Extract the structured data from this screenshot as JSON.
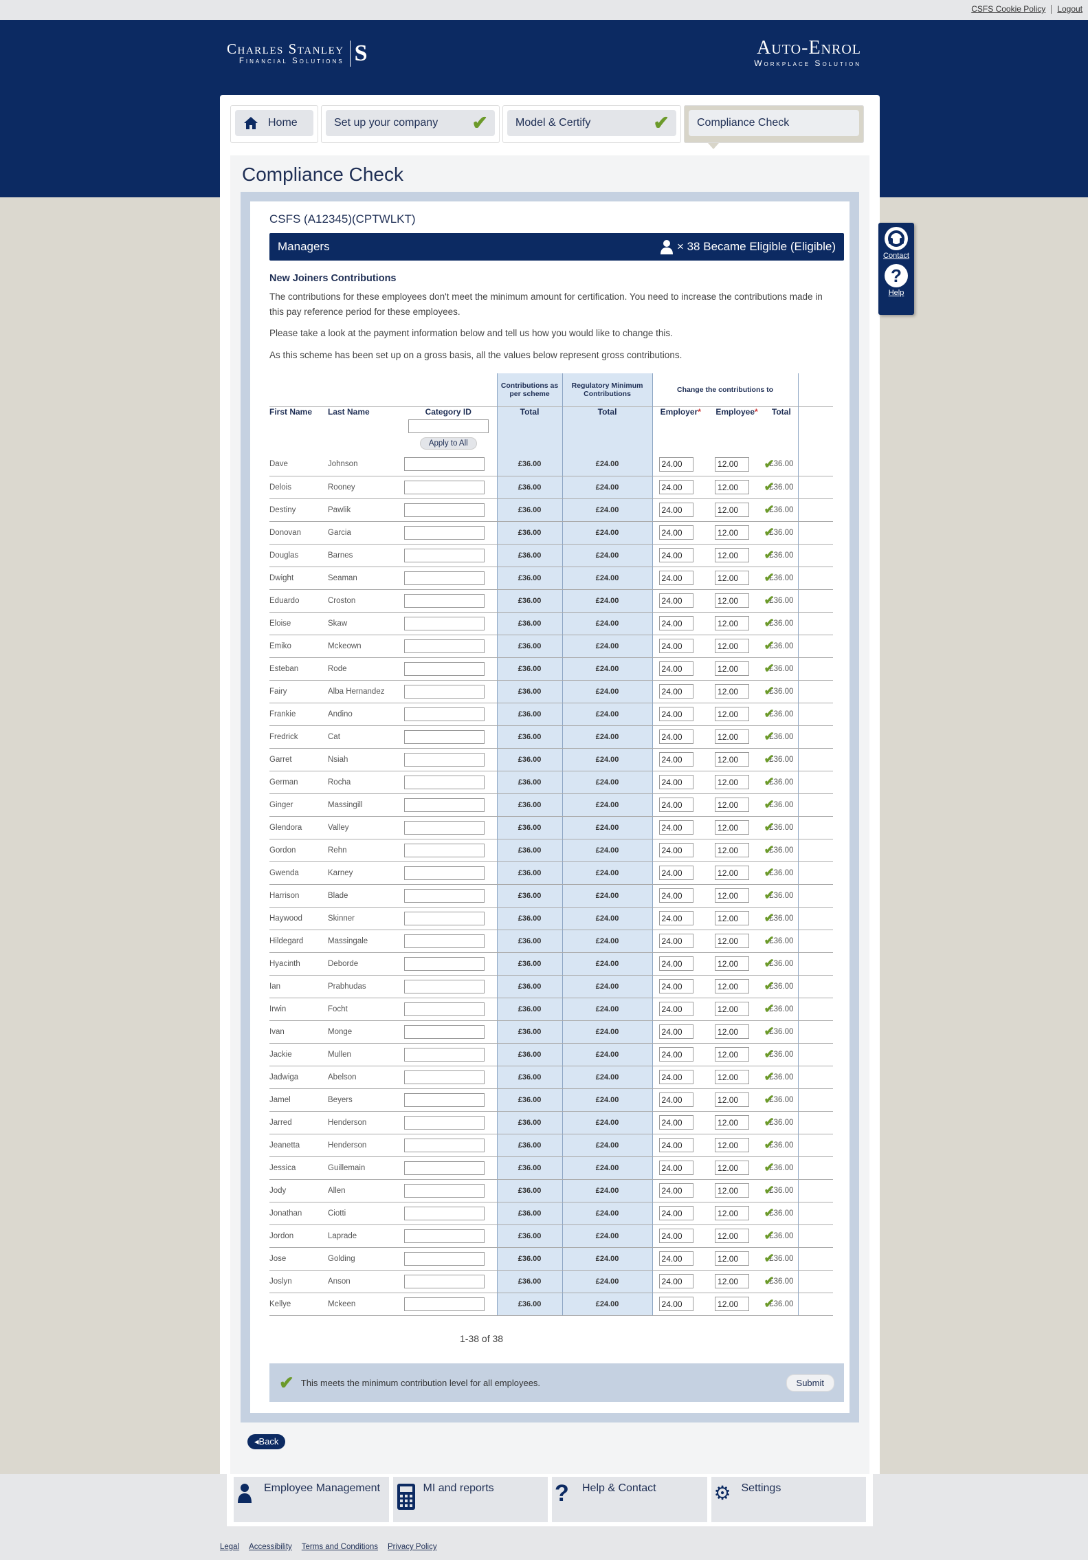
{
  "topbar": {
    "cookie_policy": "CSFS Cookie Policy",
    "logout": "Logout"
  },
  "brand": {
    "line1": "Charles Stanley",
    "line2": "Financial Solutions",
    "monogram": "S"
  },
  "product": {
    "line1": "Auto-Enrol",
    "line2": "Workplace Solution"
  },
  "tabs": [
    {
      "label": "Home",
      "icon": "home-icon"
    },
    {
      "label": "Set up your company",
      "complete": true
    },
    {
      "label": "Model & Certify",
      "complete": true
    },
    {
      "label": "Compliance Check",
      "active": true
    }
  ],
  "page": {
    "title": "Compliance Check",
    "company": "CSFS (A12345)(CPTWLKT)",
    "group": "Managers",
    "eligible_text": "× 38 Became Eligible (Eligible)",
    "section_heading": "New Joiners Contributions",
    "para1": "The contributions for these employees don't meet the minimum amount for certification. You need to increase the contributions made in this pay reference period for these employees.",
    "para2": "Please take a look at the payment information below and tell us how you would like to change this.",
    "para3": "As this scheme has been set up on a gross basis, all the values below represent gross contributions."
  },
  "table": {
    "group_headers": {
      "scheme": "Contributions as per scheme",
      "regulatory": "Regulatory Minimum Contributions",
      "change": "Change the contributions to"
    },
    "columns": {
      "first_name": "First Name",
      "last_name": "Last Name",
      "category": "Category ID",
      "total": "Total",
      "employer": "Employer",
      "employee": "Employee"
    },
    "apply_all": "Apply to All",
    "rows": [
      {
        "first": "Dave",
        "last": "Johnson",
        "scheme": "£36.00",
        "regulatory": "£24.00",
        "employer": "24.00",
        "employee": "12.00",
        "total": "£36.00"
      },
      {
        "first": "Delois",
        "last": "Rooney",
        "scheme": "£36.00",
        "regulatory": "£24.00",
        "employer": "24.00",
        "employee": "12.00",
        "total": "£36.00"
      },
      {
        "first": "Destiny",
        "last": "Pawlik",
        "scheme": "£36.00",
        "regulatory": "£24.00",
        "employer": "24.00",
        "employee": "12.00",
        "total": "£36.00"
      },
      {
        "first": "Donovan",
        "last": "Garcia",
        "scheme": "£36.00",
        "regulatory": "£24.00",
        "employer": "24.00",
        "employee": "12.00",
        "total": "£36.00"
      },
      {
        "first": "Douglas",
        "last": "Barnes",
        "scheme": "£36.00",
        "regulatory": "£24.00",
        "employer": "24.00",
        "employee": "12.00",
        "total": "£36.00"
      },
      {
        "first": "Dwight",
        "last": "Seaman",
        "scheme": "£36.00",
        "regulatory": "£24.00",
        "employer": "24.00",
        "employee": "12.00",
        "total": "£36.00"
      },
      {
        "first": "Eduardo",
        "last": "Croston",
        "scheme": "£36.00",
        "regulatory": "£24.00",
        "employer": "24.00",
        "employee": "12.00",
        "total": "£36.00"
      },
      {
        "first": "Eloise",
        "last": "Skaw",
        "scheme": "£36.00",
        "regulatory": "£24.00",
        "employer": "24.00",
        "employee": "12.00",
        "total": "£36.00"
      },
      {
        "first": "Emiko",
        "last": "Mckeown",
        "scheme": "£36.00",
        "regulatory": "£24.00",
        "employer": "24.00",
        "employee": "12.00",
        "total": "£36.00"
      },
      {
        "first": "Esteban",
        "last": "Rode",
        "scheme": "£36.00",
        "regulatory": "£24.00",
        "employer": "24.00",
        "employee": "12.00",
        "total": "£36.00"
      },
      {
        "first": "Fairy",
        "last": "Alba Hernandez",
        "scheme": "£36.00",
        "regulatory": "£24.00",
        "employer": "24.00",
        "employee": "12.00",
        "total": "£36.00"
      },
      {
        "first": "Frankie",
        "last": "Andino",
        "scheme": "£36.00",
        "regulatory": "£24.00",
        "employer": "24.00",
        "employee": "12.00",
        "total": "£36.00"
      },
      {
        "first": "Fredrick",
        "last": "Cat",
        "scheme": "£36.00",
        "regulatory": "£24.00",
        "employer": "24.00",
        "employee": "12.00",
        "total": "£36.00"
      },
      {
        "first": "Garret",
        "last": "Nsiah",
        "scheme": "£36.00",
        "regulatory": "£24.00",
        "employer": "24.00",
        "employee": "12.00",
        "total": "£36.00"
      },
      {
        "first": "German",
        "last": "Rocha",
        "scheme": "£36.00",
        "regulatory": "£24.00",
        "employer": "24.00",
        "employee": "12.00",
        "total": "£36.00"
      },
      {
        "first": "Ginger",
        "last": "Massingill",
        "scheme": "£36.00",
        "regulatory": "£24.00",
        "employer": "24.00",
        "employee": "12.00",
        "total": "£36.00"
      },
      {
        "first": "Glendora",
        "last": "Valley",
        "scheme": "£36.00",
        "regulatory": "£24.00",
        "employer": "24.00",
        "employee": "12.00",
        "total": "£36.00"
      },
      {
        "first": "Gordon",
        "last": "Rehn",
        "scheme": "£36.00",
        "regulatory": "£24.00",
        "employer": "24.00",
        "employee": "12.00",
        "total": "£36.00"
      },
      {
        "first": "Gwenda",
        "last": "Karney",
        "scheme": "£36.00",
        "regulatory": "£24.00",
        "employer": "24.00",
        "employee": "12.00",
        "total": "£36.00"
      },
      {
        "first": "Harrison",
        "last": "Blade",
        "scheme": "£36.00",
        "regulatory": "£24.00",
        "employer": "24.00",
        "employee": "12.00",
        "total": "£36.00"
      },
      {
        "first": "Haywood",
        "last": "Skinner",
        "scheme": "£36.00",
        "regulatory": "£24.00",
        "employer": "24.00",
        "employee": "12.00",
        "total": "£36.00"
      },
      {
        "first": "Hildegard",
        "last": "Massingale",
        "scheme": "£36.00",
        "regulatory": "£24.00",
        "employer": "24.00",
        "employee": "12.00",
        "total": "£36.00"
      },
      {
        "first": "Hyacinth",
        "last": "Deborde",
        "scheme": "£36.00",
        "regulatory": "£24.00",
        "employer": "24.00",
        "employee": "12.00",
        "total": "£36.00"
      },
      {
        "first": "Ian",
        "last": "Prabhudas",
        "scheme": "£36.00",
        "regulatory": "£24.00",
        "employer": "24.00",
        "employee": "12.00",
        "total": "£36.00"
      },
      {
        "first": "Irwin",
        "last": "Focht",
        "scheme": "£36.00",
        "regulatory": "£24.00",
        "employer": "24.00",
        "employee": "12.00",
        "total": "£36.00"
      },
      {
        "first": "Ivan",
        "last": "Monge",
        "scheme": "£36.00",
        "regulatory": "£24.00",
        "employer": "24.00",
        "employee": "12.00",
        "total": "£36.00"
      },
      {
        "first": "Jackie",
        "last": "Mullen",
        "scheme": "£36.00",
        "regulatory": "£24.00",
        "employer": "24.00",
        "employee": "12.00",
        "total": "£36.00"
      },
      {
        "first": "Jadwiga",
        "last": "Abelson",
        "scheme": "£36.00",
        "regulatory": "£24.00",
        "employer": "24.00",
        "employee": "12.00",
        "total": "£36.00"
      },
      {
        "first": "Jamel",
        "last": "Beyers",
        "scheme": "£36.00",
        "regulatory": "£24.00",
        "employer": "24.00",
        "employee": "12.00",
        "total": "£36.00"
      },
      {
        "first": "Jarred",
        "last": "Henderson",
        "scheme": "£36.00",
        "regulatory": "£24.00",
        "employer": "24.00",
        "employee": "12.00",
        "total": "£36.00"
      },
      {
        "first": "Jeanetta",
        "last": "Henderson",
        "scheme": "£36.00",
        "regulatory": "£24.00",
        "employer": "24.00",
        "employee": "12.00",
        "total": "£36.00"
      },
      {
        "first": "Jessica",
        "last": "Guillemain",
        "scheme": "£36.00",
        "regulatory": "£24.00",
        "employer": "24.00",
        "employee": "12.00",
        "total": "£36.00"
      },
      {
        "first": "Jody",
        "last": "Allen",
        "scheme": "£36.00",
        "regulatory": "£24.00",
        "employer": "24.00",
        "employee": "12.00",
        "total": "£36.00"
      },
      {
        "first": "Jonathan",
        "last": "Ciotti",
        "scheme": "£36.00",
        "regulatory": "£24.00",
        "employer": "24.00",
        "employee": "12.00",
        "total": "£36.00"
      },
      {
        "first": "Jordon",
        "last": "Laprade",
        "scheme": "£36.00",
        "regulatory": "£24.00",
        "employer": "24.00",
        "employee": "12.00",
        "total": "£36.00"
      },
      {
        "first": "Jose",
        "last": "Golding",
        "scheme": "£36.00",
        "regulatory": "£24.00",
        "employer": "24.00",
        "employee": "12.00",
        "total": "£36.00"
      },
      {
        "first": "Joslyn",
        "last": "Anson",
        "scheme": "£36.00",
        "regulatory": "£24.00",
        "employer": "24.00",
        "employee": "12.00",
        "total": "£36.00"
      },
      {
        "first": "Kellye",
        "last": "Mckeen",
        "scheme": "£36.00",
        "regulatory": "£24.00",
        "employer": "24.00",
        "employee": "12.00",
        "total": "£36.00"
      }
    ]
  },
  "pager": "1-38 of 38",
  "status": {
    "message": "This meets the minimum contribution level for all employees.",
    "submit": "Submit"
  },
  "back": "Back",
  "side_widget": {
    "contact": "Contact",
    "help": "Help"
  },
  "footer_tabs": [
    {
      "label": "Employee Management",
      "icon": "person-icon"
    },
    {
      "label": "MI and reports",
      "icon": "calculator-icon"
    },
    {
      "label": "Help & Contact",
      "icon": "question-icon"
    },
    {
      "label": "Settings",
      "icon": "gears-icon"
    }
  ],
  "footer_links": [
    "Legal",
    "Accessibility",
    "Terms and Conditions",
    "Privacy Policy"
  ],
  "colors": {
    "navy": "#0c2a62",
    "accent_green": "#6c9a2a",
    "light_blue": "#d8e5f3"
  }
}
